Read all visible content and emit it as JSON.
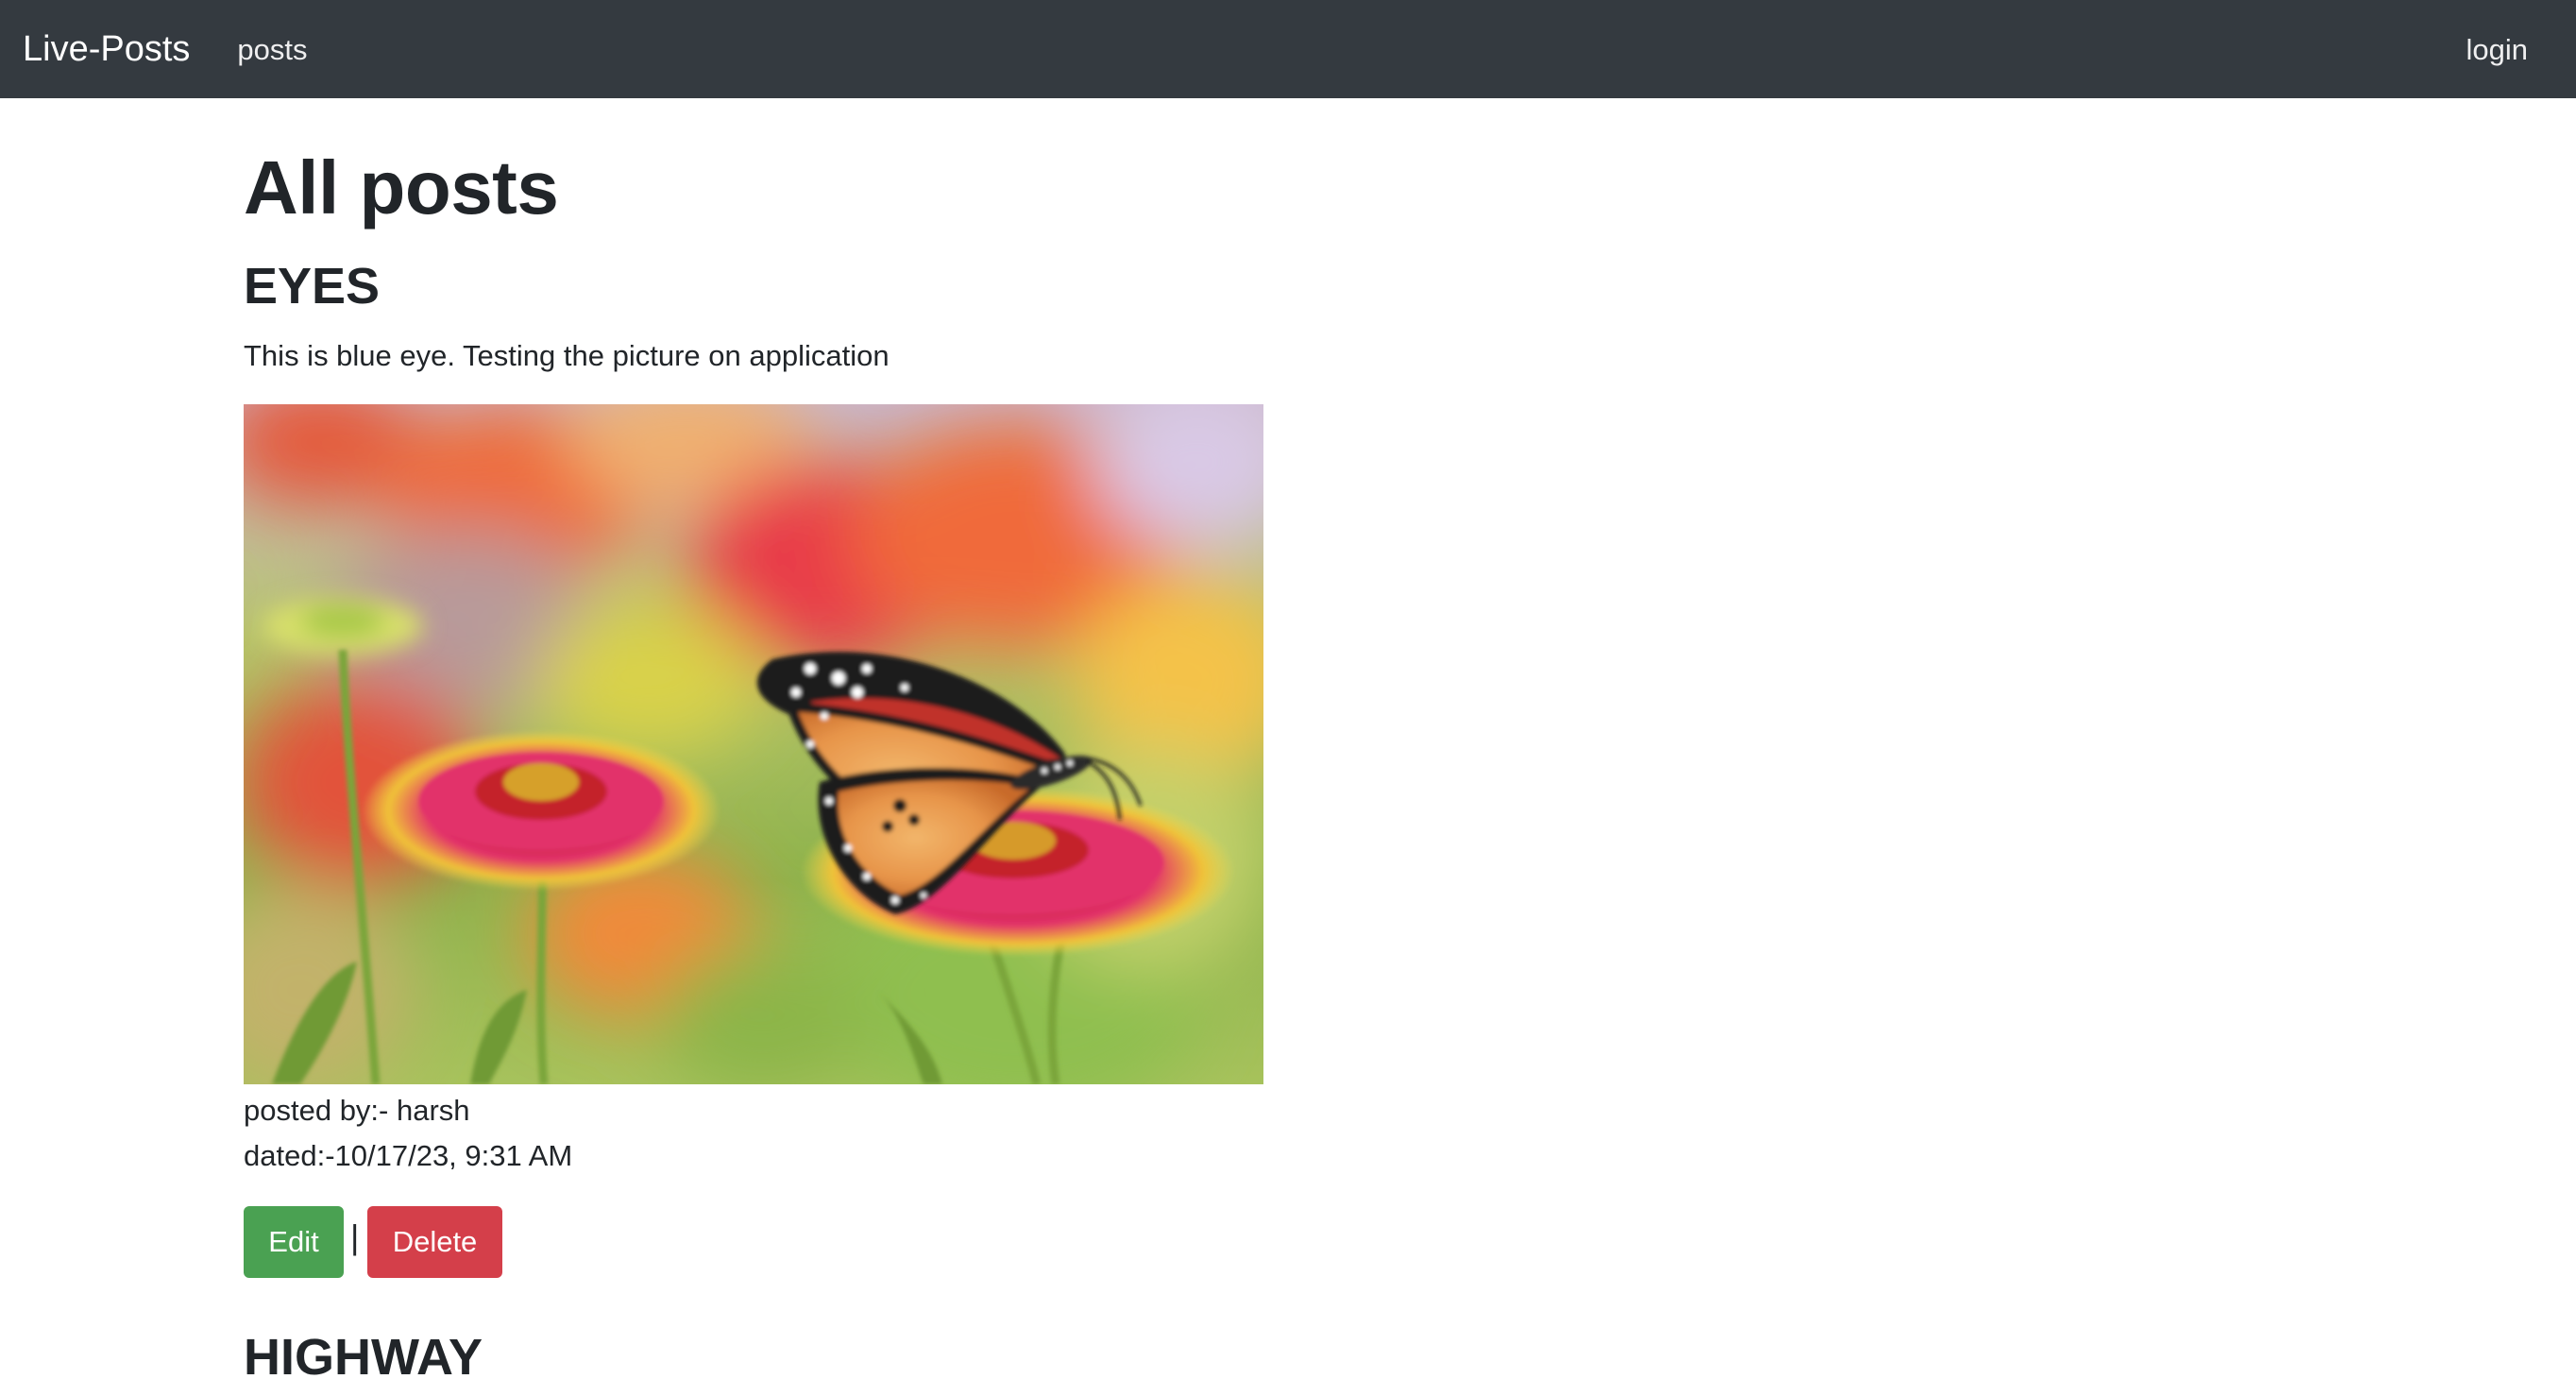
{
  "navbar": {
    "brand": "Live-Posts",
    "links": [
      {
        "label": "posts"
      }
    ],
    "login_label": "login",
    "background": "#343a40"
  },
  "main": {
    "page_title": "All posts"
  },
  "posts": [
    {
      "title": "EYES",
      "description": "This is blue eye. Testing the picture on application",
      "image_alt": "butterfly on flower",
      "posted_by": "posted by:- harsh",
      "dated": "dated:-10/17/23, 9:31 AM",
      "edit_label": "Edit",
      "divider": "|",
      "delete_label": "Delete"
    },
    {
      "title": "HIGHWAY"
    }
  ],
  "colors": {
    "edit_button": "#4aa152",
    "delete_button": "#d43f4a",
    "text": "#212529"
  }
}
